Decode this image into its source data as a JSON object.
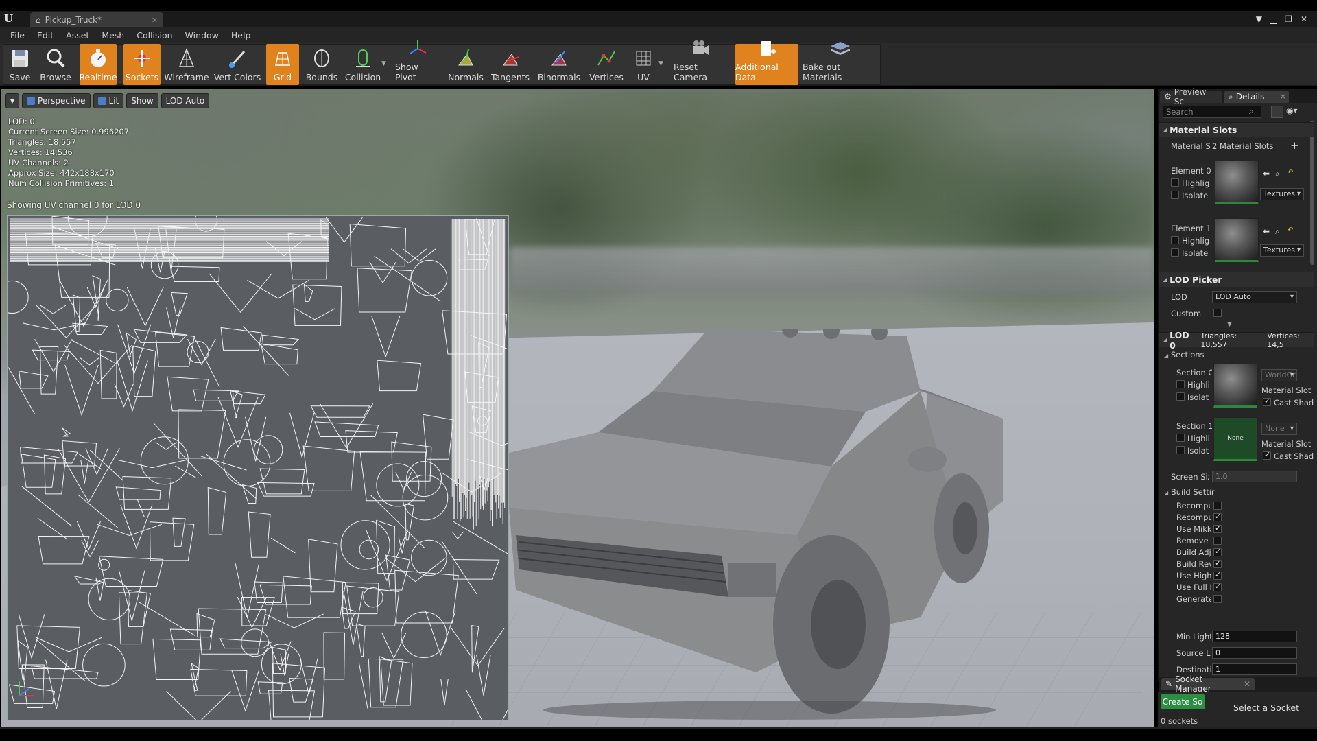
{
  "window": {
    "tab_title": "Pickup_Truck*"
  },
  "menu": [
    "File",
    "Edit",
    "Asset",
    "Mesh",
    "Collision",
    "Window",
    "Help"
  ],
  "toolbar": {
    "save": "Save",
    "browse": "Browse",
    "realtime": "Realtime",
    "sockets": "Sockets",
    "wireframe": "Wireframe",
    "vert_colors": "Vert Colors",
    "grid": "Grid",
    "bounds": "Bounds",
    "collision": "Collision",
    "show_pivot": "Show Pivot",
    "normals": "Normals",
    "tangents": "Tangents",
    "binormals": "Binormals",
    "vertices": "Vertices",
    "uv": "UV",
    "reset_camera": "Reset Camera",
    "additional_data": "Additional Data",
    "bake_out": "Bake out Materials",
    "accent_color": "#e0821e"
  },
  "viewport": {
    "perspective": "Perspective",
    "lit": "Lit",
    "show": "Show",
    "lod": "LOD Auto",
    "stats": [
      "LOD:  0",
      "Current Screen Size:  0.996207",
      "Triangles:  18,557",
      "Vertices:  14,536",
      "UV Channels:  2",
      "Approx Size: 442x188x170",
      "Num Collision Primitives:  1"
    ],
    "uv_caption": "Showing UV channel 0 for LOD 0"
  },
  "panel": {
    "tab_preview": "Preview Sc",
    "tab_details": "Details",
    "search_placeholder": "Search",
    "material_slots": {
      "header": "Material Slots",
      "label": "Material Sl",
      "value": "2 Material Slots",
      "elements": [
        {
          "label": "Element 0",
          "highlight": "Highligh",
          "isolate": "Isolate",
          "combo": "Textures"
        },
        {
          "label": "Element 1",
          "highlight": "Highligh",
          "isolate": "Isolate",
          "combo": "Textures"
        }
      ]
    },
    "lod_picker": {
      "header": "LOD Picker",
      "lod_label": "LOD",
      "lod_value": "LOD Auto",
      "custom_label": "Custom"
    },
    "lod0": {
      "header": "LOD 0",
      "triangles": "Triangles: 18,557",
      "vertices": "Vertices: 14,5",
      "sections_header": "Sections",
      "sections": [
        {
          "label": "Section C",
          "highlight": "Highli",
          "isolate": "Isolat",
          "combo": "WorldGr",
          "slot": "Material Slot",
          "cast": "Cast Shado",
          "thumb": ""
        },
        {
          "label": "Section 1",
          "highlight": "Highli",
          "isolate": "Isolat",
          "combo": "None",
          "slot": "Material Slot",
          "cast": "Cast Shado",
          "thumb": "None"
        }
      ],
      "screen_size_label": "Screen Siz",
      "screen_size_value": "1.0",
      "build_settings": "Build Settir",
      "build_rows": [
        {
          "label": "Recompu",
          "checked": false
        },
        {
          "label": "Recompu",
          "checked": true
        },
        {
          "label": "Use Mikk",
          "checked": true
        },
        {
          "label": "Remove",
          "checked": false
        },
        {
          "label": "Build Adj",
          "checked": true
        },
        {
          "label": "Build Rev",
          "checked": true
        },
        {
          "label": "Use High",
          "checked": true
        },
        {
          "label": "Use Full I",
          "checked": true
        },
        {
          "label": "Generate",
          "checked": false
        }
      ],
      "min_light_label": "Min Light",
      "min_light_value": "128",
      "source_label": "Source L",
      "source_value": "0",
      "dest_label": "Destinati",
      "dest_value": "1"
    }
  },
  "socket_manager": {
    "tab": "Socket Manager",
    "create": "Create So",
    "count": "0 sockets",
    "hint": "Select a Socket"
  }
}
